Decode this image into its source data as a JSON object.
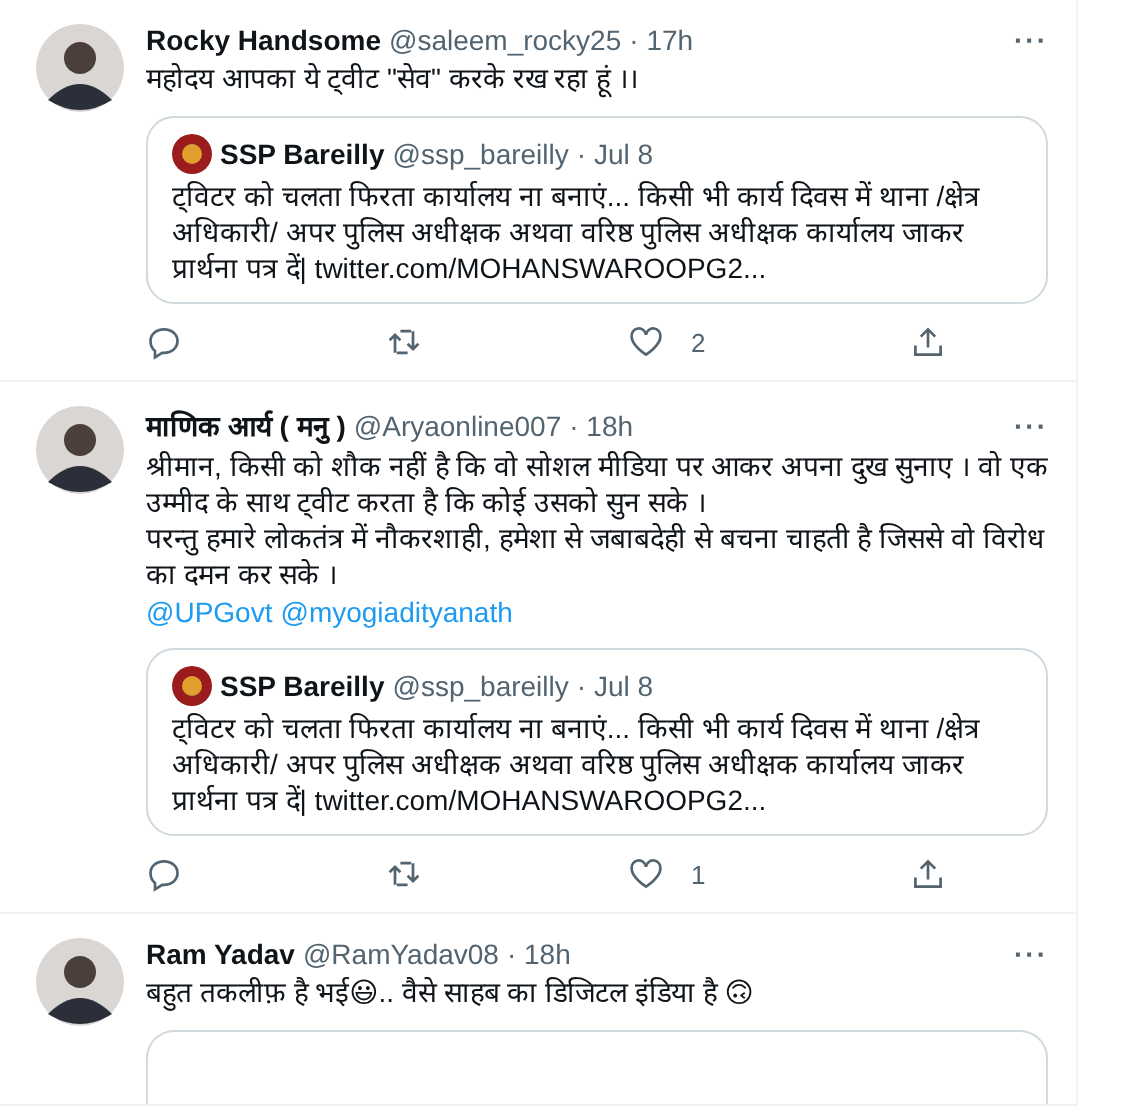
{
  "tweets": [
    {
      "name": "Rocky Handsome",
      "handle": "@saleem_rocky25",
      "time": "· 17h",
      "more": "···",
      "paragraphs": [
        "महोदय आपका ये ट्वीट \"सेव\" करके रख रहा हूं ।।"
      ],
      "quote": {
        "name": "SSP Bareilly",
        "handle": "@ssp_bareilly",
        "time": "· Jul 8",
        "text": "ट्विटर को चलता फिरता कार्यालय ना बनाएं... किसी भी कार्य दिवस में थाना /क्षेत्र अधिकारी/ अपर पुलिस अधीक्षक अथवा वरिष्ठ पुलिस अधीक्षक कार्यालय जाकर प्रार्थना पत्र दें| twitter.com/MOHANSWAROOPG2..."
      },
      "like_count": "2"
    },
    {
      "name": "माणिक आर्य ( मनु )",
      "handle": "@Aryaonline007",
      "time": "· 18h",
      "more": "···",
      "paragraphs": [
        "श्रीमान, किसी को शौक नहीं है कि वो सोशल मीडिया पर आकर अपना दुख सुनाए । वो एक उम्मीद के साथ ट्वीट करता है कि कोई उसको सुन सके ।",
        "परन्तु हमारे लोकतंत्र में नौकरशाही, हमेशा से जबाबदेही से बचना चाहती है जिससे वो विरोध का दमन कर सके ।"
      ],
      "mentions": [
        "@UPGovt",
        "@myogiadityanath"
      ],
      "quote": {
        "name": "SSP Bareilly",
        "handle": "@ssp_bareilly",
        "time": "· Jul 8",
        "text": "ट्विटर को चलता फिरता कार्यालय ना बनाएं... किसी भी कार्य दिवस में थाना /क्षेत्र अधिकारी/ अपर पुलिस अधीक्षक अथवा वरिष्ठ पुलिस अधीक्षक कार्यालय जाकर प्रार्थना पत्र दें| twitter.com/MOHANSWAROOPG2..."
      },
      "like_count": "1"
    },
    {
      "name": "Ram Yadav",
      "handle": "@RamYadav08",
      "time": "· 18h",
      "more": "···",
      "paragraphs": [
        "बहुत तकलीफ़ है भई😃.. वैसे साहब का डिजिटल इंडिया है 🙃"
      ],
      "quote_cut": true
    }
  ]
}
